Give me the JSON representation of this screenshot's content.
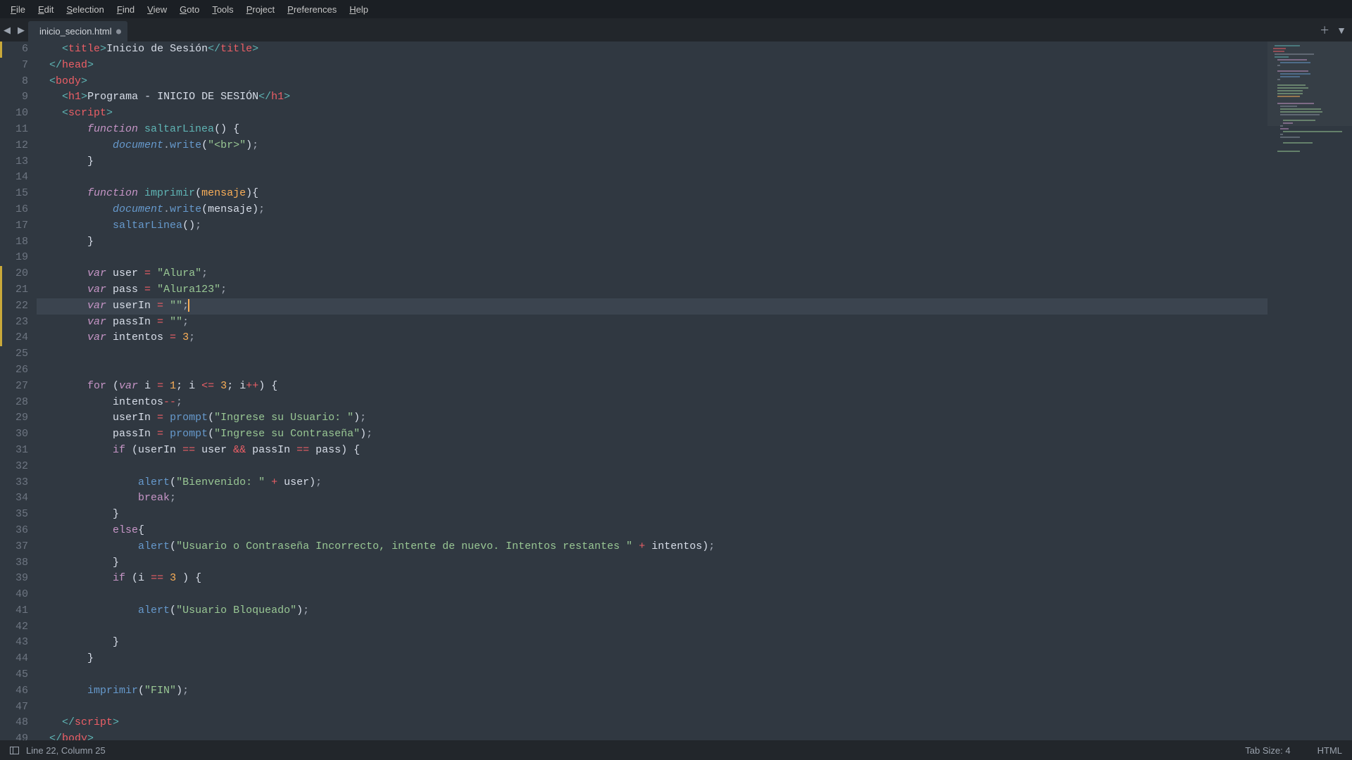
{
  "menu": [
    "File",
    "Edit",
    "Selection",
    "Find",
    "View",
    "Goto",
    "Tools",
    "Project",
    "Preferences",
    "Help"
  ],
  "tab": {
    "title": "inicio_secion.html",
    "dirty": true
  },
  "status": {
    "pos": "Line 22, Column 25",
    "tabsize": "Tab Size: 4",
    "lang": "HTML"
  },
  "first_line_no": 6,
  "highlight_line_no": 22,
  "modified_lines": [
    6,
    20,
    21,
    22,
    23,
    24
  ],
  "code": [
    [
      [
        "    ",
        "c-text"
      ],
      [
        "<",
        "c-punc"
      ],
      [
        "title",
        "c-tag"
      ],
      [
        ">",
        "c-punc"
      ],
      [
        "Inicio de Sesión",
        "c-text"
      ],
      [
        "</",
        "c-punc"
      ],
      [
        "title",
        "c-tag"
      ],
      [
        ">",
        "c-punc"
      ]
    ],
    [
      [
        "  ",
        "c-text"
      ],
      [
        "</",
        "c-punc"
      ],
      [
        "head",
        "c-tag"
      ],
      [
        ">",
        "c-punc"
      ]
    ],
    [
      [
        "  ",
        "c-text"
      ],
      [
        "<",
        "c-punc"
      ],
      [
        "body",
        "c-tag"
      ],
      [
        ">",
        "c-punc"
      ]
    ],
    [
      [
        "    ",
        "c-text"
      ],
      [
        "<",
        "c-punc"
      ],
      [
        "h1",
        "c-tag"
      ],
      [
        ">",
        "c-punc"
      ],
      [
        "Programa - INICIO DE SESIÓN",
        "c-text"
      ],
      [
        "</",
        "c-punc"
      ],
      [
        "h1",
        "c-tag"
      ],
      [
        ">",
        "c-punc"
      ]
    ],
    [
      [
        "    ",
        "c-text"
      ],
      [
        "<",
        "c-punc"
      ],
      [
        "script",
        "c-tag"
      ],
      [
        ">",
        "c-punc"
      ]
    ],
    [
      [
        "        ",
        "c-text"
      ],
      [
        "function",
        "c-kw"
      ],
      [
        " ",
        "c-text"
      ],
      [
        "saltarLinea",
        "c-func"
      ],
      [
        "(",
        "c-text"
      ],
      [
        ")",
        "c-text"
      ],
      [
        " {",
        "c-text"
      ]
    ],
    [
      [
        "            ",
        "c-text"
      ],
      [
        "document",
        "c-obj"
      ],
      [
        ".",
        "c-punc2"
      ],
      [
        "write",
        "c-call"
      ],
      [
        "(",
        "c-text"
      ],
      [
        "\"<br>\"",
        "c-str"
      ],
      [
        ")",
        "c-text"
      ],
      [
        ";",
        "c-punc2"
      ]
    ],
    [
      [
        "        }",
        "c-text"
      ]
    ],
    [
      [
        "",
        "c-text"
      ]
    ],
    [
      [
        "        ",
        "c-text"
      ],
      [
        "function",
        "c-kw"
      ],
      [
        " ",
        "c-text"
      ],
      [
        "imprimir",
        "c-func"
      ],
      [
        "(",
        "c-text"
      ],
      [
        "mensaje",
        "c-param"
      ],
      [
        ")",
        "c-text"
      ],
      [
        "{",
        "c-text"
      ]
    ],
    [
      [
        "            ",
        "c-text"
      ],
      [
        "document",
        "c-obj"
      ],
      [
        ".",
        "c-punc2"
      ],
      [
        "write",
        "c-call"
      ],
      [
        "(",
        "c-text"
      ],
      [
        "mensaje",
        "c-text"
      ],
      [
        ")",
        "c-text"
      ],
      [
        ";",
        "c-punc2"
      ]
    ],
    [
      [
        "            ",
        "c-text"
      ],
      [
        "saltarLinea",
        "c-call"
      ],
      [
        "(",
        "c-text"
      ],
      [
        ")",
        "c-text"
      ],
      [
        ";",
        "c-punc2"
      ]
    ],
    [
      [
        "        }",
        "c-text"
      ]
    ],
    [
      [
        "",
        "c-text"
      ]
    ],
    [
      [
        "        ",
        "c-text"
      ],
      [
        "var",
        "c-kw"
      ],
      [
        " user ",
        "c-text"
      ],
      [
        "=",
        "c-op"
      ],
      [
        " ",
        "c-text"
      ],
      [
        "\"Alura\"",
        "c-str"
      ],
      [
        ";",
        "c-punc2"
      ]
    ],
    [
      [
        "        ",
        "c-text"
      ],
      [
        "var",
        "c-kw"
      ],
      [
        " pass ",
        "c-text"
      ],
      [
        "=",
        "c-op"
      ],
      [
        " ",
        "c-text"
      ],
      [
        "\"Alura123\"",
        "c-str"
      ],
      [
        ";",
        "c-punc2"
      ]
    ],
    [
      [
        "        ",
        "c-text"
      ],
      [
        "var",
        "c-kw"
      ],
      [
        " userIn ",
        "c-text"
      ],
      [
        "=",
        "c-op"
      ],
      [
        " ",
        "c-text"
      ],
      [
        "\"\"",
        "c-str"
      ],
      [
        ";",
        "c-punc2"
      ]
    ],
    [
      [
        "        ",
        "c-text"
      ],
      [
        "var",
        "c-kw"
      ],
      [
        " passIn ",
        "c-text"
      ],
      [
        "=",
        "c-op"
      ],
      [
        " ",
        "c-text"
      ],
      [
        "\"\"",
        "c-str"
      ],
      [
        ";",
        "c-punc2"
      ]
    ],
    [
      [
        "        ",
        "c-text"
      ],
      [
        "var",
        "c-kw"
      ],
      [
        " intentos ",
        "c-text"
      ],
      [
        "=",
        "c-op"
      ],
      [
        " ",
        "c-text"
      ],
      [
        "3",
        "c-num"
      ],
      [
        ";",
        "c-punc2"
      ]
    ],
    [
      [
        "",
        "c-text"
      ]
    ],
    [
      [
        "",
        "c-text"
      ]
    ],
    [
      [
        "        ",
        "c-text"
      ],
      [
        "for",
        "c-kw-n"
      ],
      [
        " (",
        "c-text"
      ],
      [
        "var",
        "c-kw"
      ],
      [
        " i ",
        "c-text"
      ],
      [
        "=",
        "c-op"
      ],
      [
        " ",
        "c-text"
      ],
      [
        "1",
        "c-num"
      ],
      [
        "; i ",
        "c-text"
      ],
      [
        "<=",
        "c-op"
      ],
      [
        " ",
        "c-text"
      ],
      [
        "3",
        "c-num"
      ],
      [
        "; i",
        "c-text"
      ],
      [
        "++",
        "c-op"
      ],
      [
        ") {",
        "c-text"
      ]
    ],
    [
      [
        "            intentos",
        "c-text"
      ],
      [
        "--",
        "c-op"
      ],
      [
        ";",
        "c-punc2"
      ]
    ],
    [
      [
        "            userIn ",
        "c-text"
      ],
      [
        "=",
        "c-op"
      ],
      [
        " ",
        "c-text"
      ],
      [
        "prompt",
        "c-call"
      ],
      [
        "(",
        "c-text"
      ],
      [
        "\"Ingrese su Usuario: \"",
        "c-str"
      ],
      [
        ")",
        "c-text"
      ],
      [
        ";",
        "c-punc2"
      ]
    ],
    [
      [
        "            passIn ",
        "c-text"
      ],
      [
        "=",
        "c-op"
      ],
      [
        " ",
        "c-text"
      ],
      [
        "prompt",
        "c-call"
      ],
      [
        "(",
        "c-text"
      ],
      [
        "\"Ingrese su Contraseña\"",
        "c-str"
      ],
      [
        ")",
        "c-text"
      ],
      [
        ";",
        "c-punc2"
      ]
    ],
    [
      [
        "            ",
        "c-text"
      ],
      [
        "if",
        "c-kw-n"
      ],
      [
        " (userIn ",
        "c-text"
      ],
      [
        "==",
        "c-op"
      ],
      [
        " user ",
        "c-text"
      ],
      [
        "&&",
        "c-op"
      ],
      [
        " passIn ",
        "c-text"
      ],
      [
        "==",
        "c-op"
      ],
      [
        " pass) {",
        "c-text"
      ]
    ],
    [
      [
        "",
        "c-text"
      ]
    ],
    [
      [
        "                ",
        "c-text"
      ],
      [
        "alert",
        "c-call"
      ],
      [
        "(",
        "c-text"
      ],
      [
        "\"Bienvenido: \"",
        "c-str"
      ],
      [
        " ",
        "c-text"
      ],
      [
        "+",
        "c-op"
      ],
      [
        " user)",
        "c-text"
      ],
      [
        ";",
        "c-punc2"
      ]
    ],
    [
      [
        "                ",
        "c-text"
      ],
      [
        "break",
        "c-kw-n"
      ],
      [
        ";",
        "c-punc2"
      ]
    ],
    [
      [
        "            }",
        "c-text"
      ]
    ],
    [
      [
        "            ",
        "c-text"
      ],
      [
        "else",
        "c-kw-n"
      ],
      [
        "{",
        "c-text"
      ]
    ],
    [
      [
        "                ",
        "c-text"
      ],
      [
        "alert",
        "c-call"
      ],
      [
        "(",
        "c-text"
      ],
      [
        "\"Usuario o Contraseña Incorrecto, intente de nuevo. Intentos restantes \"",
        "c-str"
      ],
      [
        " ",
        "c-text"
      ],
      [
        "+",
        "c-op"
      ],
      [
        " intentos)",
        "c-text"
      ],
      [
        ";",
        "c-punc2"
      ]
    ],
    [
      [
        "            }",
        "c-text"
      ]
    ],
    [
      [
        "            ",
        "c-text"
      ],
      [
        "if",
        "c-kw-n"
      ],
      [
        " (i ",
        "c-text"
      ],
      [
        "==",
        "c-op"
      ],
      [
        " ",
        "c-text"
      ],
      [
        "3",
        "c-num"
      ],
      [
        " ) {",
        "c-text"
      ]
    ],
    [
      [
        "",
        "c-text"
      ]
    ],
    [
      [
        "                ",
        "c-text"
      ],
      [
        "alert",
        "c-call"
      ],
      [
        "(",
        "c-text"
      ],
      [
        "\"Usuario Bloqueado\"",
        "c-str"
      ],
      [
        ")",
        "c-text"
      ],
      [
        ";",
        "c-punc2"
      ]
    ],
    [
      [
        "",
        "c-text"
      ]
    ],
    [
      [
        "            }",
        "c-text"
      ]
    ],
    [
      [
        "        }",
        "c-text"
      ]
    ],
    [
      [
        "",
        "c-text"
      ]
    ],
    [
      [
        "        ",
        "c-text"
      ],
      [
        "imprimir",
        "c-call"
      ],
      [
        "(",
        "c-text"
      ],
      [
        "\"FIN\"",
        "c-str"
      ],
      [
        ")",
        "c-text"
      ],
      [
        ";",
        "c-punc2"
      ]
    ],
    [
      [
        "",
        "c-text"
      ]
    ],
    [
      [
        "    ",
        "c-text"
      ],
      [
        "</",
        "c-punc"
      ],
      [
        "script",
        "c-tag"
      ],
      [
        ">",
        "c-punc"
      ]
    ],
    [
      [
        "  ",
        "c-text"
      ],
      [
        "</",
        "c-punc"
      ],
      [
        "body",
        "c-tag"
      ],
      [
        ">",
        "c-punc"
      ]
    ]
  ]
}
